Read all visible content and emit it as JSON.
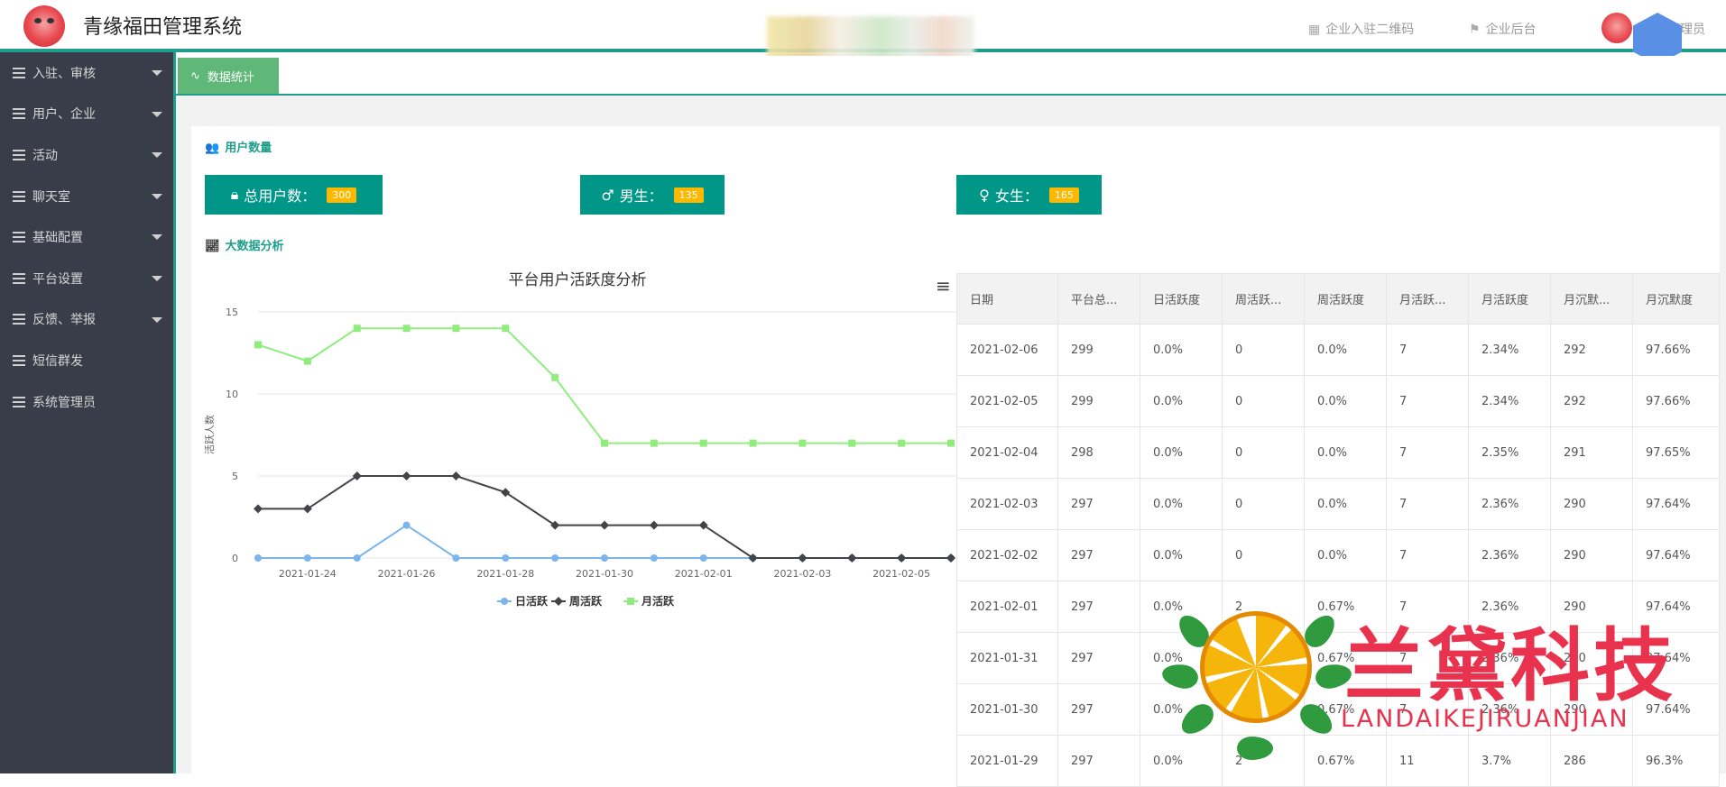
{
  "app": {
    "title": "青缘福田管理系统"
  },
  "topnav": {
    "qrcode_label": "企业入驻二维码",
    "backend_label": "企业后台",
    "admin_label": "管理员"
  },
  "sidebar": {
    "items": [
      {
        "label": "入驻、审核",
        "has_caret": true
      },
      {
        "label": "用户、企业",
        "has_caret": true
      },
      {
        "label": "活动",
        "has_caret": true
      },
      {
        "label": "聊天室",
        "has_caret": true
      },
      {
        "label": "基础配置",
        "has_caret": true
      },
      {
        "label": "平台设置",
        "has_caret": true
      },
      {
        "label": "反馈、举报",
        "has_caret": true
      },
      {
        "label": "短信群发",
        "has_caret": false
      },
      {
        "label": "系统管理员",
        "has_caret": false
      }
    ]
  },
  "tabs": [
    {
      "label": "数据统计",
      "active": true
    }
  ],
  "user_section": {
    "title": "用户数量"
  },
  "stats": {
    "total": {
      "label": "总用户数：",
      "value": "300"
    },
    "male": {
      "label": "男生：",
      "value": "135"
    },
    "female": {
      "label": "女生：",
      "value": "165"
    }
  },
  "analysis_section": {
    "title": "大数据分析"
  },
  "chart_data": {
    "type": "line",
    "title": "平台用户活跃度分析",
    "xlabel": "",
    "ylabel": "活跃人数",
    "ylim": [
      0,
      15
    ],
    "yticks": [
      0,
      5,
      10,
      15
    ],
    "x": [
      "2021-01-23",
      "2021-01-24",
      "2021-01-25",
      "2021-01-26",
      "2021-01-27",
      "2021-01-28",
      "2021-01-29",
      "2021-01-30",
      "2021-01-31",
      "2021-02-01",
      "2021-02-02",
      "2021-02-03",
      "2021-02-04",
      "2021-02-05",
      "2021-02-06"
    ],
    "xtick_labels": [
      "2021-01-24",
      "2021-01-26",
      "2021-01-28",
      "2021-01-30",
      "2021-02-01",
      "2021-02-03",
      "2021-02-05"
    ],
    "series": [
      {
        "name": "日活跃",
        "color": "#7cb5ec",
        "marker": "circle",
        "values": [
          0,
          0,
          0,
          2,
          0,
          0,
          0,
          0,
          0,
          0,
          0,
          0,
          0,
          0,
          0
        ]
      },
      {
        "name": "周活跃",
        "color": "#434348",
        "marker": "diamond",
        "values": [
          3,
          3,
          5,
          5,
          5,
          4,
          2,
          2,
          2,
          2,
          0,
          0,
          0,
          0,
          0
        ]
      },
      {
        "name": "月活跃",
        "color": "#90ed7d",
        "marker": "square",
        "values": [
          13,
          12,
          14,
          14,
          14,
          14,
          11,
          7,
          7,
          7,
          7,
          7,
          7,
          7,
          7
        ]
      }
    ],
    "legend_position": "bottom-center",
    "grid": true
  },
  "table": {
    "headers": [
      "日期",
      "平台总...",
      "日活跃度",
      "周活跃...",
      "周活跃度",
      "月活跃...",
      "月活跃度",
      "月沉默...",
      "月沉默度"
    ],
    "rows": [
      [
        "2021-02-06",
        "299",
        "0.0%",
        "0",
        "0.0%",
        "7",
        "2.34%",
        "292",
        "97.66%"
      ],
      [
        "2021-02-05",
        "299",
        "0.0%",
        "0",
        "0.0%",
        "7",
        "2.34%",
        "292",
        "97.66%"
      ],
      [
        "2021-02-04",
        "298",
        "0.0%",
        "0",
        "0.0%",
        "7",
        "2.35%",
        "291",
        "97.65%"
      ],
      [
        "2021-02-03",
        "297",
        "0.0%",
        "0",
        "0.0%",
        "7",
        "2.36%",
        "290",
        "97.64%"
      ],
      [
        "2021-02-02",
        "297",
        "0.0%",
        "0",
        "0.0%",
        "7",
        "2.36%",
        "290",
        "97.64%"
      ],
      [
        "2021-02-01",
        "297",
        "0.0%",
        "2",
        "0.67%",
        "7",
        "2.36%",
        "290",
        "97.64%"
      ],
      [
        "2021-01-31",
        "297",
        "0.0%",
        "2",
        "0.67%",
        "7",
        "2.36%",
        "290",
        "97.64%"
      ],
      [
        "2021-01-30",
        "297",
        "0.0%",
        "2",
        "0.67%",
        "7",
        "2.36%",
        "290",
        "97.64%"
      ],
      [
        "2021-01-29",
        "297",
        "0.0%",
        "2",
        "0.67%",
        "11",
        "3.7%",
        "286",
        "96.3%"
      ]
    ]
  },
  "watermark": {
    "cn": "兰黛科技",
    "en": "LANDAIKEJIRUANJIAN"
  },
  "colors": {
    "teal": "#009688",
    "sidebar": "#393d49",
    "tab_active": "#5fb878",
    "badge": "#ffb800"
  }
}
